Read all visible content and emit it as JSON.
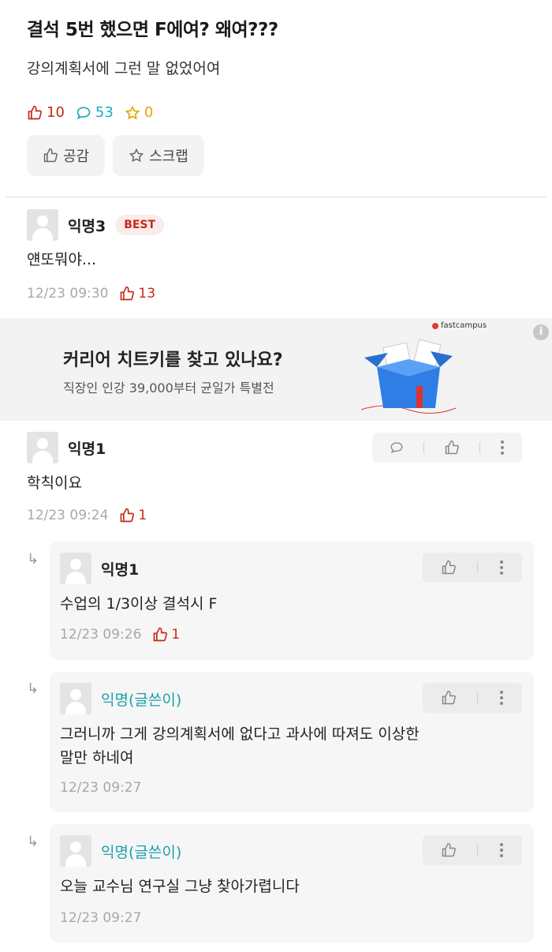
{
  "post": {
    "title": "결석 5번 했으면 F에여? 왜여???",
    "body": "강의계획서에 그런 말 없었어여",
    "likes": "10",
    "comments": "53",
    "scraps": "0",
    "like_button": "공감",
    "scrap_button": "스크랩"
  },
  "comments": [
    {
      "author": "익명3",
      "badge": "BEST",
      "text": "얜또뭐야...",
      "time": "12/23 09:30",
      "likes": "13"
    },
    {
      "author": "익명1",
      "text": "학칙이요",
      "time": "12/23 09:24",
      "likes": "1"
    }
  ],
  "ad": {
    "title": "커리어 치트키를 찾고 있나요?",
    "subtitle": "직장인 인강 39,000부터 균일가 특별전",
    "brand": "fastcampus",
    "info_icon": "i"
  },
  "replies": [
    {
      "author": "익명1",
      "text": "수업의 1/3이상 결석시 F",
      "time": "12/23 09:26",
      "likes": "1"
    },
    {
      "author": "익명(글쓴이)",
      "text_line1": "그러니까 그게 강의계획서에 없다고 과사에 따져도 이상한",
      "text_line2": "말만 하네여",
      "time": "12/23 09:27"
    },
    {
      "author": "익명(글쓴이)",
      "text": "오늘 교수님 연구실 그냥 찾아가렵니다",
      "time": "12/23 09:27"
    }
  ],
  "icons": [
    "thumbs-up-icon",
    "comment-icon",
    "star-icon",
    "more-icon",
    "reply-arrow-icon"
  ],
  "colors": {
    "like": "#c62917",
    "comment": "#1eaaba",
    "scrap": "#e7a600",
    "op": "#1aa0ab"
  }
}
